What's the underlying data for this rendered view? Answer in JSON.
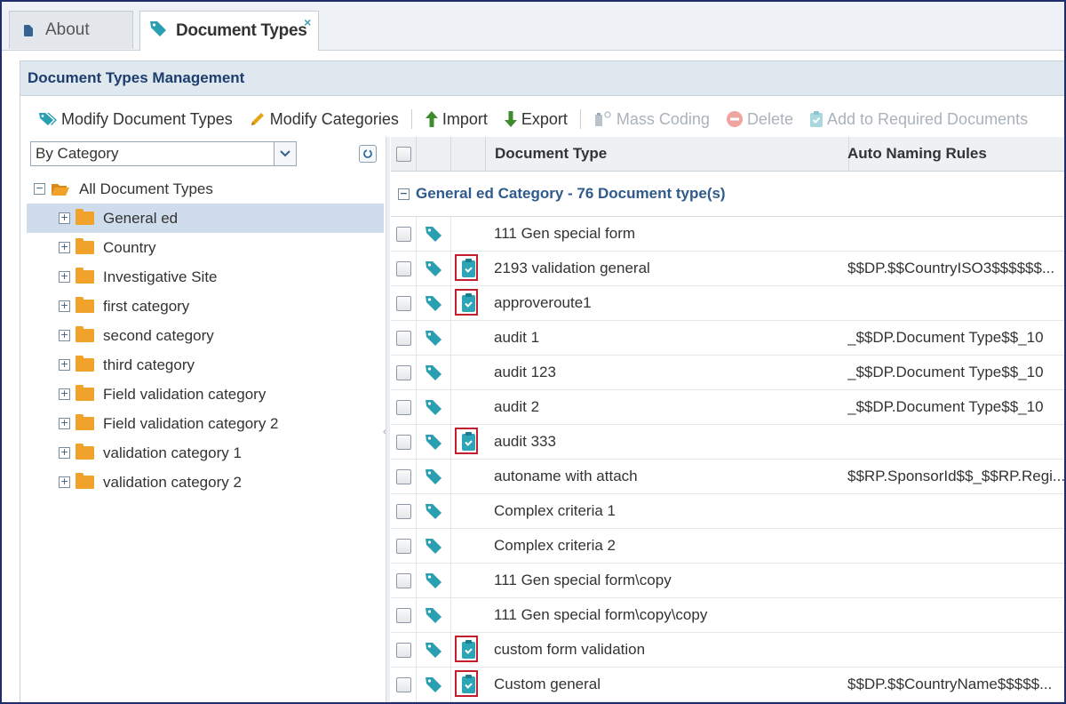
{
  "tabs": [
    {
      "label": "About",
      "icon": "document-icon"
    },
    {
      "label": "Document Types",
      "icon": "tag-icon",
      "close": "×"
    }
  ],
  "panel": {
    "title": "Document Types Management"
  },
  "toolbar": {
    "modify_types": "Modify Document Types",
    "modify_categories": "Modify Categories",
    "import": "Import",
    "export": "Export",
    "mass_coding": "Mass Coding",
    "delete": "Delete",
    "add_required": "Add to Required Documents"
  },
  "filter": {
    "value": "By Category"
  },
  "tree": {
    "root": "All Document Types",
    "items": [
      "General ed",
      "Country",
      "Investigative Site",
      "first category",
      "second category",
      "third category",
      "Field validation category",
      "Field validation category 2",
      "validation category 1",
      "validation category 2"
    ],
    "selected_index": 0
  },
  "grid": {
    "headers": {
      "type": "Document Type",
      "rules": "Auto Naming Rules"
    },
    "group_label": "General ed Category - 76 Document type(s)",
    "rows": [
      {
        "name": "111 Gen special form",
        "rule": "",
        "required": false
      },
      {
        "name": "2193 validation general",
        "rule": "$$DP.$$CountryISO3$$$$$$...",
        "required": true
      },
      {
        "name": "approveroute1",
        "rule": "",
        "required": true
      },
      {
        "name": "audit 1",
        "rule": "_$$DP.Document Type$$_10",
        "required": false
      },
      {
        "name": "audit 123",
        "rule": "_$$DP.Document Type$$_10",
        "required": false
      },
      {
        "name": "audit 2",
        "rule": "_$$DP.Document Type$$_10",
        "required": false
      },
      {
        "name": "audit 333",
        "rule": "",
        "required": true
      },
      {
        "name": "autoname with attach",
        "rule": "$$RP.SponsorId$$_$$RP.Regi...",
        "required": false
      },
      {
        "name": "Complex criteria 1",
        "rule": "",
        "required": false
      },
      {
        "name": "Complex criteria 2",
        "rule": "",
        "required": false
      },
      {
        "name": "111 Gen special form\\copy",
        "rule": "",
        "required": false
      },
      {
        "name": "111 Gen special form\\copy\\copy",
        "rule": "",
        "required": false
      },
      {
        "name": "custom form validation",
        "rule": "",
        "required": true
      },
      {
        "name": "Custom general",
        "rule": "$$DP.$$CountryName$$$$$...",
        "required": true
      }
    ]
  },
  "colors": {
    "accent": "#2ca5b6",
    "folder": "#f0a22a",
    "highlight": "#c41e2e",
    "header": "#1d3e6e"
  }
}
